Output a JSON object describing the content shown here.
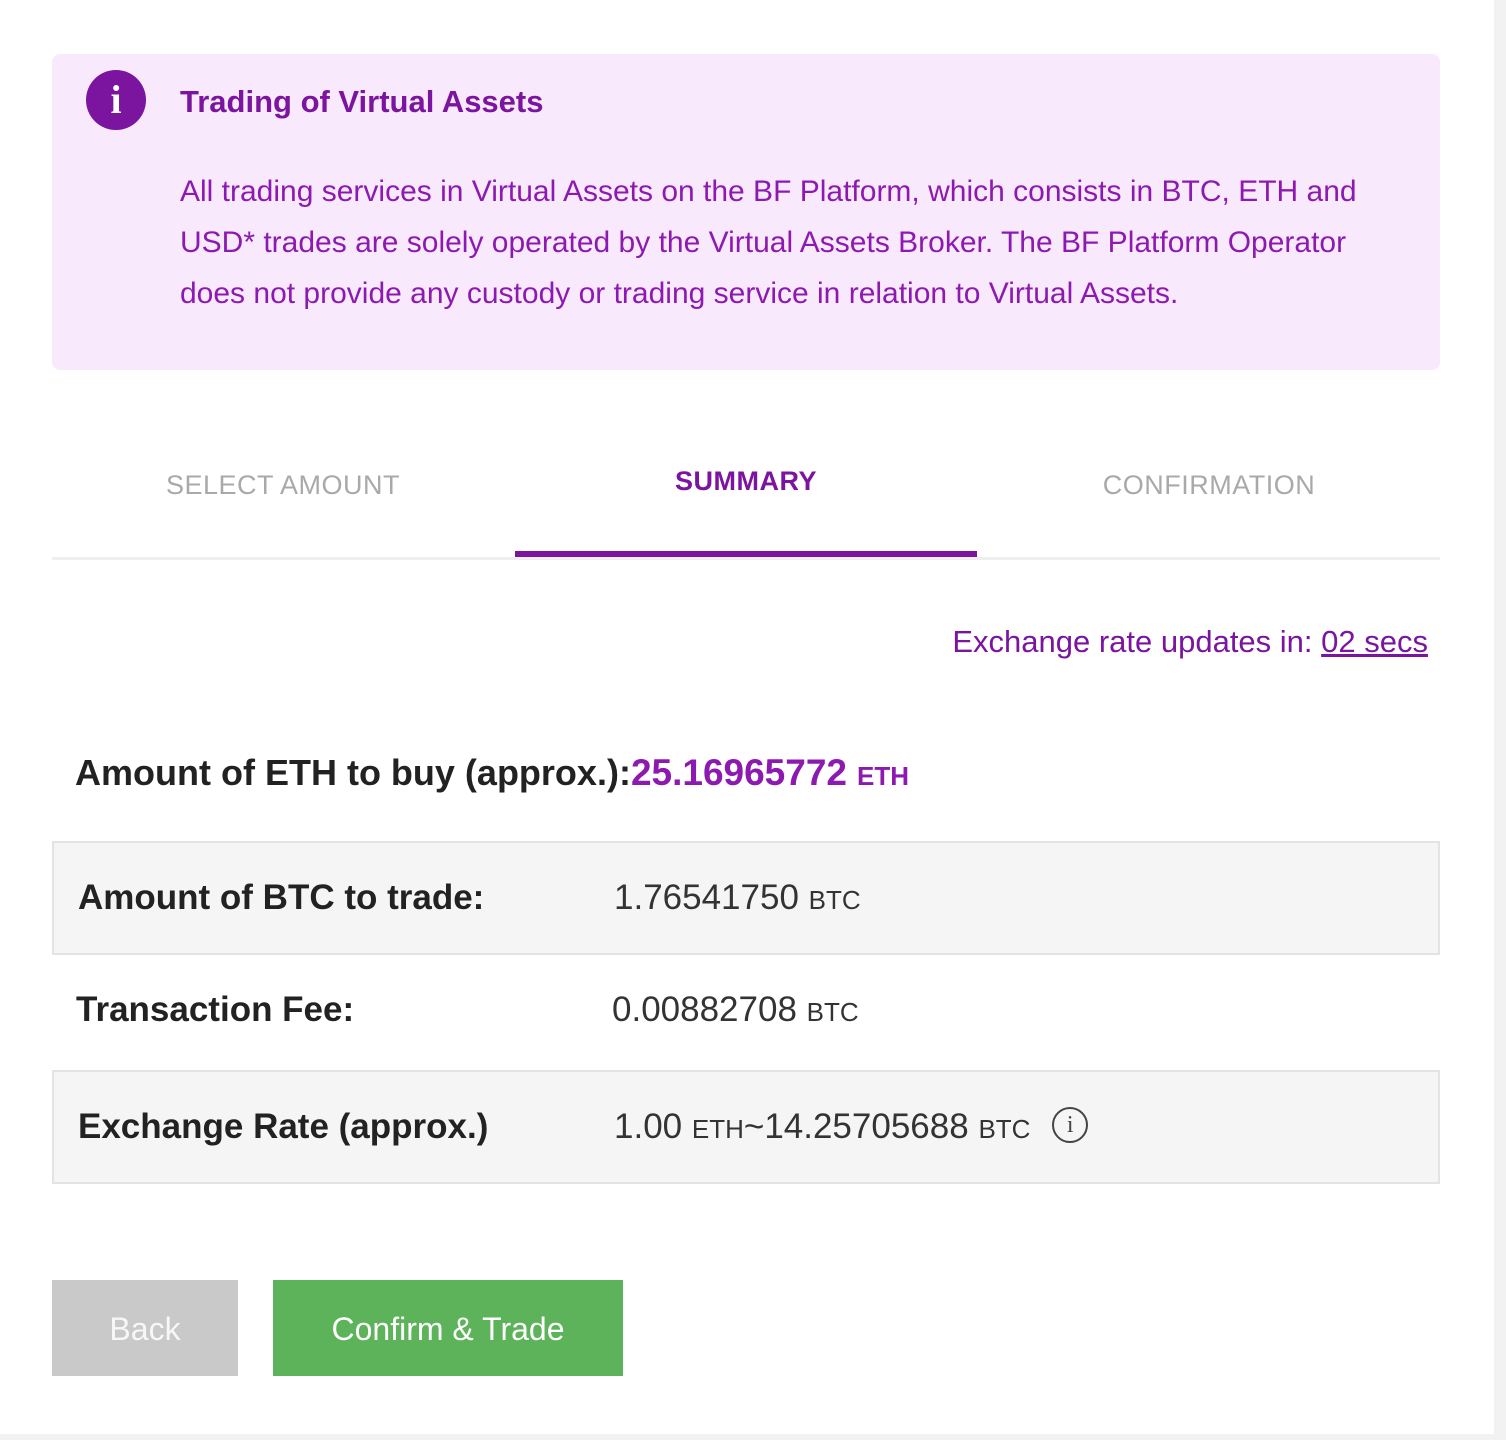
{
  "notice": {
    "title": "Trading of Virtual Assets",
    "body": "All trading services in Virtual Assets on the BF Platform, which consists in BTC, ETH and USD* trades are solely operated by the Virtual Assets Broker. The BF Platform Operator does not provide any custody or trading service in relation to Virtual Assets.",
    "icon": "info-icon"
  },
  "tabs": [
    {
      "label": "SELECT AMOUNT",
      "active": false
    },
    {
      "label": "SUMMARY",
      "active": true
    },
    {
      "label": "CONFIRMATION",
      "active": false
    }
  ],
  "countdown": {
    "label": "Exchange rate updates in:",
    "value": "02 secs"
  },
  "summary": {
    "buy_label": "Amount of ETH to buy (approx.):",
    "buy_value": "25.16965772",
    "buy_unit": "ETH",
    "rows": [
      {
        "label": "Amount of BTC to trade:",
        "value": "1.76541750",
        "unit": "BTC"
      },
      {
        "label": "Transaction Fee:",
        "value": "0.00882708",
        "unit": "BTC"
      },
      {
        "label": "Exchange Rate (approx.)",
        "value_left": "1.00",
        "unit_left": "ETH",
        "separator": "~",
        "value_right": "14.25705688",
        "unit_right": "BTC"
      }
    ]
  },
  "buttons": {
    "back": "Back",
    "confirm": "Confirm & Trade"
  },
  "colors": {
    "brand": "#7b149e",
    "notice_bg": "#f8e9fc",
    "confirm": "#5cb35a",
    "back": "#c9c9c9"
  }
}
